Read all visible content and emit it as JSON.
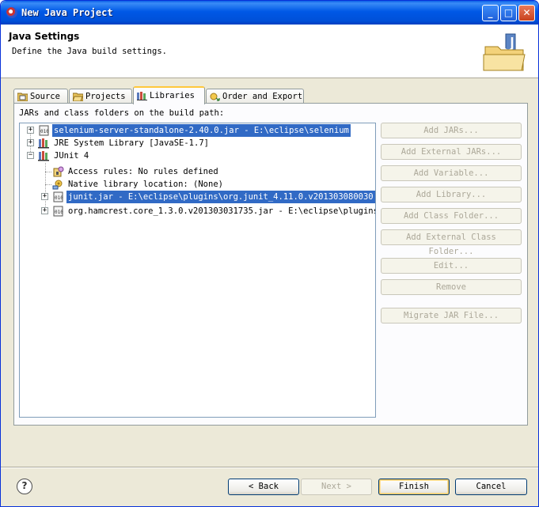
{
  "window": {
    "title": "New Java Project"
  },
  "header": {
    "title": "Java Settings",
    "description": "Define the Java build settings."
  },
  "tabs": [
    {
      "label": "Source",
      "selected": false
    },
    {
      "label": "Projects",
      "selected": false
    },
    {
      "label": "Libraries",
      "selected": true
    },
    {
      "label": "Order and Export",
      "selected": false
    }
  ],
  "libraries": {
    "label": "JARs and class folders on the build path:",
    "tree": [
      {
        "text": "selenium-server-standalone-2.40.0.jar - E:\\eclipse\\selenium",
        "selected": true
      },
      {
        "text": "JRE System Library [JavaSE-1.7]",
        "selected": false
      },
      {
        "text": "JUnit 4",
        "selected": false
      },
      {
        "text": "Access rules: No rules defined",
        "selected": false
      },
      {
        "text": "Native library location: (None)",
        "selected": false
      },
      {
        "text": "junit.jar - E:\\eclipse\\plugins\\org.junit_4.11.0.v201303080030",
        "selected": true
      },
      {
        "text": "org.hamcrest.core_1.3.0.v201303031735.jar - E:\\eclipse\\plugins",
        "selected": false
      }
    ]
  },
  "side_buttons": [
    "Add JARs...",
    "Add External JARs...",
    "Add Variable...",
    "Add Library...",
    "Add Class Folder...",
    "Add External Class Folder...",
    "Edit...",
    "Remove",
    "Migrate JAR File..."
  ],
  "footer": {
    "help": "?",
    "back": "< Back",
    "next": "Next >",
    "finish": "Finish",
    "cancel": "Cancel"
  },
  "colors": {
    "selection": "#316ac5",
    "titlebar": "#0058e6",
    "tab_highlight": "#ffc83c"
  }
}
